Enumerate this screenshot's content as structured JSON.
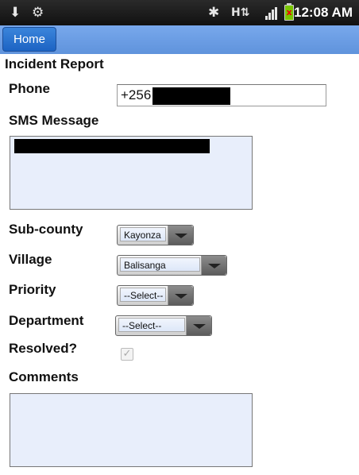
{
  "status_bar": {
    "time": "12:08 AM",
    "icons": [
      "usb-icon",
      "android-debug-icon",
      "bluetooth-icon",
      "hsdpa-data-icon",
      "signal-icon",
      "battery-icon"
    ],
    "data_label": "H"
  },
  "nav": {
    "home_label": "Home"
  },
  "form": {
    "title": "Incident Report",
    "phone": {
      "label": "Phone",
      "value": "+256"
    },
    "sms": {
      "label": "SMS Message"
    },
    "subcounty": {
      "label": "Sub-county",
      "value": "Kayonza"
    },
    "village": {
      "label": "Village",
      "value": "Balisanga"
    },
    "priority": {
      "label": "Priority",
      "value": "--Select--"
    },
    "department": {
      "label": "Department",
      "value": "--Select--"
    },
    "resolved": {
      "label": "Resolved?",
      "checked": true
    },
    "comments": {
      "label": "Comments",
      "value": ""
    }
  },
  "colors": {
    "status_bar_bg": "#1c1c1c",
    "top_bar_bg": "#6d9ee4",
    "home_button_bg": "#2a74d0",
    "textarea_bg": "#e8eefb",
    "battery_green": "#79c400"
  }
}
